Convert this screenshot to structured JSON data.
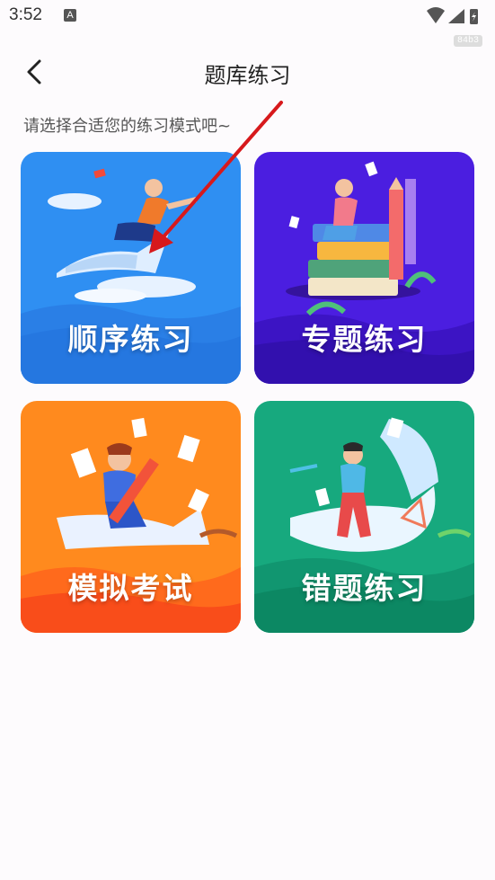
{
  "status_bar": {
    "time": "3:52",
    "a_icon": "A",
    "badge": "84b3"
  },
  "header": {
    "title": "题库练习",
    "back_icon": "chevron-left-icon"
  },
  "subtitle": "请选择合适您的练习模式吧~",
  "cards": [
    {
      "label": "顺序练习",
      "color": "#2f8ff2"
    },
    {
      "label": "专题练习",
      "color": "#4b1ee0"
    },
    {
      "label": "模拟考试",
      "color": "#ff8a1e"
    },
    {
      "label": "错题练习",
      "color": "#17a97e"
    }
  ],
  "annotation": {
    "arrow_color": "#d7191c"
  }
}
